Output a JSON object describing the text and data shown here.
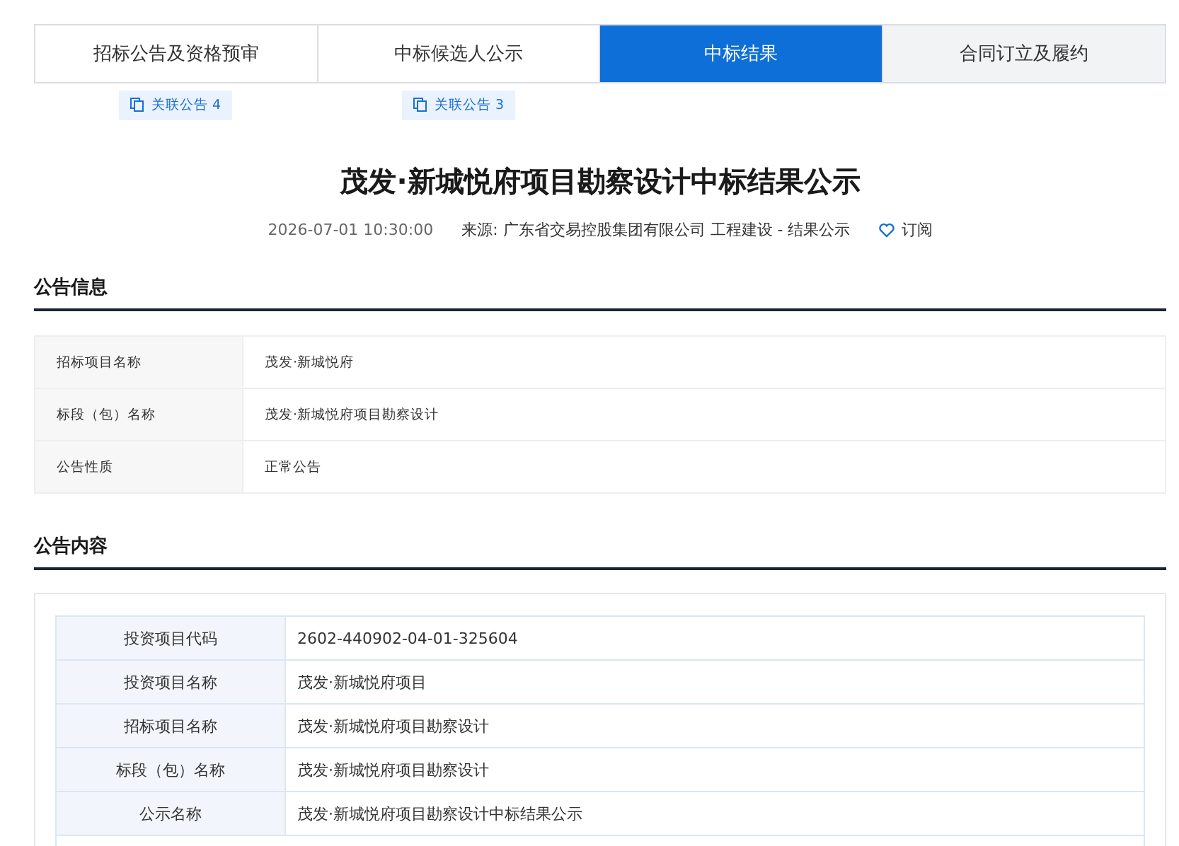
{
  "tabs": [
    {
      "label": "招标公告及资格预审",
      "selected": false,
      "badge": "关联公告 4"
    },
    {
      "label": "中标候选人公示",
      "selected": false,
      "badge": "关联公告 3"
    },
    {
      "label": "中标结果",
      "selected": true
    },
    {
      "label": "合同订立及履约",
      "selected": false
    }
  ],
  "title": "茂发·新城悦府项目勘察设计中标结果公示",
  "meta": {
    "time": "2026-07-01 10:30:00",
    "source": "来源: 广东省交易控股集团有限公司 工程建设 - 结果公示",
    "subscribe": "订阅"
  },
  "info_section": {
    "heading": "公告信息",
    "rows": [
      {
        "label": "招标项目名称",
        "value": "茂发·新城悦府"
      },
      {
        "label": "标段（包）名称",
        "value": "茂发·新城悦府项目勘察设计"
      },
      {
        "label": "公告性质",
        "value": "正常公告"
      }
    ]
  },
  "content_section": {
    "heading": "公告内容",
    "rows": [
      {
        "label": "投资项目代码",
        "value": "2602-440902-04-01-325604"
      },
      {
        "label": "投资项目名称",
        "value": "茂发·新城悦府项目"
      },
      {
        "label": "招标项目名称",
        "value": "茂发·新城悦府项目勘察设计"
      },
      {
        "label": "标段（包）名称",
        "value": "茂发·新城悦府项目勘察设计"
      },
      {
        "label": "公示名称",
        "value": "茂发·新城悦府项目勘察设计中标结果公示"
      }
    ]
  }
}
